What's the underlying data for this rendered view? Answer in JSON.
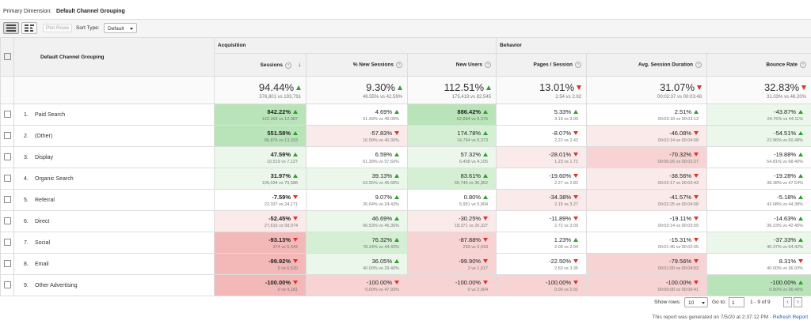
{
  "primary_dimension": {
    "label": "Primary Dimension:",
    "value": "Default Channel Grouping"
  },
  "toolbar": {
    "plot_rows": "Plot Rows",
    "sort_type_label": "Sort Type:",
    "sort_type_value": "Default"
  },
  "groups": {
    "acquisition": "Acquisition",
    "behavior": "Behavior"
  },
  "columns": {
    "dimension": "Default Channel Grouping",
    "sessions": "Sessions",
    "new_sessions": "% New Sessions",
    "new_users": "New Users",
    "pages_session": "Pages / Session",
    "avg_duration": "Avg. Session Duration",
    "bounce_rate": "Bounce Rate"
  },
  "totals": [
    {
      "value": "94.44%",
      "dir": "up",
      "sub": "376,801 vs 193,791"
    },
    {
      "value": "9.30%",
      "dir": "up",
      "sub": "46.55% vs 42.59%"
    },
    {
      "value": "112.51%",
      "dir": "up",
      "sub": "175,419 vs 82,545"
    },
    {
      "value": "13.01%",
      "dir": "down",
      "sub": "2.54 vs 2.92"
    },
    {
      "value": "31.07%",
      "dir": "down",
      "sub": "00:02:37 vs 00:03:48"
    },
    {
      "value": "32.83%",
      "dir": "down",
      "sub": "31.03% vs 46.20%"
    }
  ],
  "rows": [
    {
      "idx": "1.",
      "name": "Paid Search",
      "cells": [
        {
          "v": "842.22%",
          "d": "up",
          "s": "122,366 vs 12,987",
          "c": "g3",
          "b": true
        },
        {
          "v": "4.69%",
          "d": "up",
          "s": "51.39% vs 49.09%",
          "c": "w",
          "b": false
        },
        {
          "v": "886.42%",
          "d": "up",
          "s": "62,884 vs 6,375",
          "c": "g3",
          "b": true
        },
        {
          "v": "5.33%",
          "d": "up",
          "s": "3.16 vs 3.00",
          "c": "w",
          "b": false
        },
        {
          "v": "2.51%",
          "d": "up",
          "s": "00:03:18 vs 00:03:13",
          "c": "w",
          "b": false
        },
        {
          "v": "-43.87%",
          "d": "up",
          "s": "24.76% vs 44.11%",
          "c": "g1",
          "b": false
        }
      ]
    },
    {
      "idx": "2.",
      "name": "(Other)",
      "cells": [
        {
          "v": "551.58%",
          "d": "up",
          "s": "86,875 vs 13,333",
          "c": "g3",
          "b": true
        },
        {
          "v": "-57.83%",
          "d": "down",
          "s": "16.99% vs 40.30%",
          "c": "r1",
          "b": false
        },
        {
          "v": "174.78%",
          "d": "up",
          "s": "14,764 vs 5,373",
          "c": "g2",
          "b": false
        },
        {
          "v": "-8.07%",
          "d": "down",
          "s": "2.22 vs 2.42",
          "c": "w",
          "b": false
        },
        {
          "v": "-46.08%",
          "d": "down",
          "s": "00:02:14 vs 00:04:08",
          "c": "r1",
          "b": false
        },
        {
          "v": "-54.51%",
          "d": "up",
          "s": "22.96% vs 50.48%",
          "c": "g1",
          "b": false
        }
      ]
    },
    {
      "idx": "3.",
      "name": "Display",
      "cells": [
        {
          "v": "47.59%",
          "d": "up",
          "s": "10,519 vs 7,127",
          "c": "g1",
          "b": true
        },
        {
          "v": "6.59%",
          "d": "up",
          "s": "61.39% vs 57.60%",
          "c": "w",
          "b": false
        },
        {
          "v": "57.32%",
          "d": "up",
          "s": "6,458 vs 4,105",
          "c": "g1",
          "b": false
        },
        {
          "v": "-28.01%",
          "d": "down",
          "s": "1.23 vs 1.71",
          "c": "r1",
          "b": false
        },
        {
          "v": "-70.32%",
          "d": "down",
          "s": "00:00:26 vs 00:01:27",
          "c": "r2",
          "b": false
        },
        {
          "v": "-19.88%",
          "d": "up",
          "s": "54.81% vs 68.40%",
          "c": "w",
          "b": false
        }
      ]
    },
    {
      "idx": "4.",
      "name": "Organic Search",
      "cells": [
        {
          "v": "31.97%",
          "d": "up",
          "s": "105,034 vs 79,588",
          "c": "g1",
          "b": true
        },
        {
          "v": "39.13%",
          "d": "up",
          "s": "63.55% vs 45.68%",
          "c": "g1",
          "b": false
        },
        {
          "v": "83.61%",
          "d": "up",
          "s": "66,745 vs 36,352",
          "c": "g2",
          "b": false
        },
        {
          "v": "-19.60%",
          "d": "down",
          "s": "2.27 vs 2.82",
          "c": "w",
          "b": false
        },
        {
          "v": "-38.56%",
          "d": "down",
          "s": "00:02:17 vs 00:03:43",
          "c": "r1",
          "b": false
        },
        {
          "v": "-19.28%",
          "d": "up",
          "s": "38.38% vs 47.54%",
          "c": "w",
          "b": false
        }
      ]
    },
    {
      "idx": "5.",
      "name": "Referral",
      "cells": [
        {
          "v": "-7.59%",
          "d": "down",
          "s": "22,337 vs 24,171",
          "c": "w",
          "b": true
        },
        {
          "v": "9.07%",
          "d": "up",
          "s": "26.64% vs 24.43%",
          "c": "w",
          "b": false
        },
        {
          "v": "0.80%",
          "d": "up",
          "s": "5,951 vs 5,904",
          "c": "w",
          "b": false
        },
        {
          "v": "-34.38%",
          "d": "down",
          "s": "2.15 vs 3.27",
          "c": "r1",
          "b": false
        },
        {
          "v": "-41.57%",
          "d": "down",
          "s": "00:02:25 vs 00:04:08",
          "c": "r1",
          "b": false
        },
        {
          "v": "-5.18%",
          "d": "up",
          "s": "42.08% vs 44.38%",
          "c": "w",
          "b": false
        }
      ]
    },
    {
      "idx": "6.",
      "name": "Direct",
      "cells": [
        {
          "v": "-52.45%",
          "d": "down",
          "s": "27,615 vs 58,074",
          "c": "r1",
          "b": true
        },
        {
          "v": "46.69%",
          "d": "up",
          "s": "66.53% vs 45.35%",
          "c": "g1",
          "b": false
        },
        {
          "v": "-30.25%",
          "d": "down",
          "s": "18,371 vs 26,337",
          "c": "r1",
          "b": false
        },
        {
          "v": "-11.89%",
          "d": "down",
          "s": "2.72 vs 3.09",
          "c": "w",
          "b": false
        },
        {
          "v": "-19.11%",
          "d": "down",
          "s": "00:03:14 vs 00:03:59",
          "c": "w",
          "b": false
        },
        {
          "v": "-14.63%",
          "d": "up",
          "s": "36.23% vs 42.45%",
          "c": "w",
          "b": false
        }
      ]
    },
    {
      "idx": "7.",
      "name": "Social",
      "cells": [
        {
          "v": "-93.13%",
          "d": "down",
          "s": "374 vs 5,442",
          "c": "r3",
          "b": true
        },
        {
          "v": "76.32%",
          "d": "up",
          "s": "78.34% vs 44.43%",
          "c": "g2",
          "b": false
        },
        {
          "v": "-87.88%",
          "d": "down",
          "s": "293 vs 2,418",
          "c": "r2",
          "b": false
        },
        {
          "v": "1.23%",
          "d": "up",
          "s": "2.06 vs 2.04",
          "c": "w",
          "b": false
        },
        {
          "v": "-15.31%",
          "d": "down",
          "s": "00:01:46 vs 00:02:05",
          "c": "w",
          "b": false
        },
        {
          "v": "-37.33%",
          "d": "up",
          "s": "40.37% vs 64.42%",
          "c": "g1",
          "b": false
        }
      ]
    },
    {
      "idx": "8.",
      "name": "Email",
      "cells": [
        {
          "v": "-99.92%",
          "d": "down",
          "s": "5 vs 6,520",
          "c": "r3",
          "b": true
        },
        {
          "v": "36.05%",
          "d": "up",
          "s": "40.00% vs 29.40%",
          "c": "g1",
          "b": false
        },
        {
          "v": "-99.90%",
          "d": "down",
          "s": "2 vs 1,917",
          "c": "r2",
          "b": false
        },
        {
          "v": "-22.50%",
          "d": "down",
          "s": "2.60 vs 3.35",
          "c": "w",
          "b": false
        },
        {
          "v": "-79.56%",
          "d": "down",
          "s": "00:01:00 vs 00:04:53",
          "c": "r2",
          "b": false
        },
        {
          "v": "8.31%",
          "d": "down",
          "s": "40.00% vs 36.93%",
          "c": "w",
          "b": false
        }
      ]
    },
    {
      "idx": "9.",
      "name": "Other Advertising",
      "cells": [
        {
          "v": "-100.00%",
          "d": "down",
          "s": "0 vs 4,181",
          "c": "r3",
          "b": true
        },
        {
          "v": "-100.00%",
          "d": "down",
          "s": "0.00% vs 47.93%",
          "c": "r2",
          "b": false
        },
        {
          "v": "-100.00%",
          "d": "down",
          "s": "0 vs 2,004",
          "c": "r2",
          "b": false
        },
        {
          "v": "-100.00%",
          "d": "down",
          "s": "0.00 vs 2.91",
          "c": "r2",
          "b": false
        },
        {
          "v": "-100.00%",
          "d": "down",
          "s": "00:00:00 vs 00:06:41",
          "c": "r2",
          "b": false
        },
        {
          "v": "-100.00%",
          "d": "up",
          "s": "0.00% vs 36.40%",
          "c": "g3",
          "b": false
        }
      ]
    }
  ],
  "pagination": {
    "show_rows_label": "Show rows:",
    "show_rows_value": "10",
    "goto_label": "Go to:",
    "goto_value": "1",
    "range": "1 - 9 of 9"
  },
  "footer": {
    "text": "This report was generated on 7/5/20 at 2:37:12 PM -",
    "link": "Refresh Report"
  }
}
